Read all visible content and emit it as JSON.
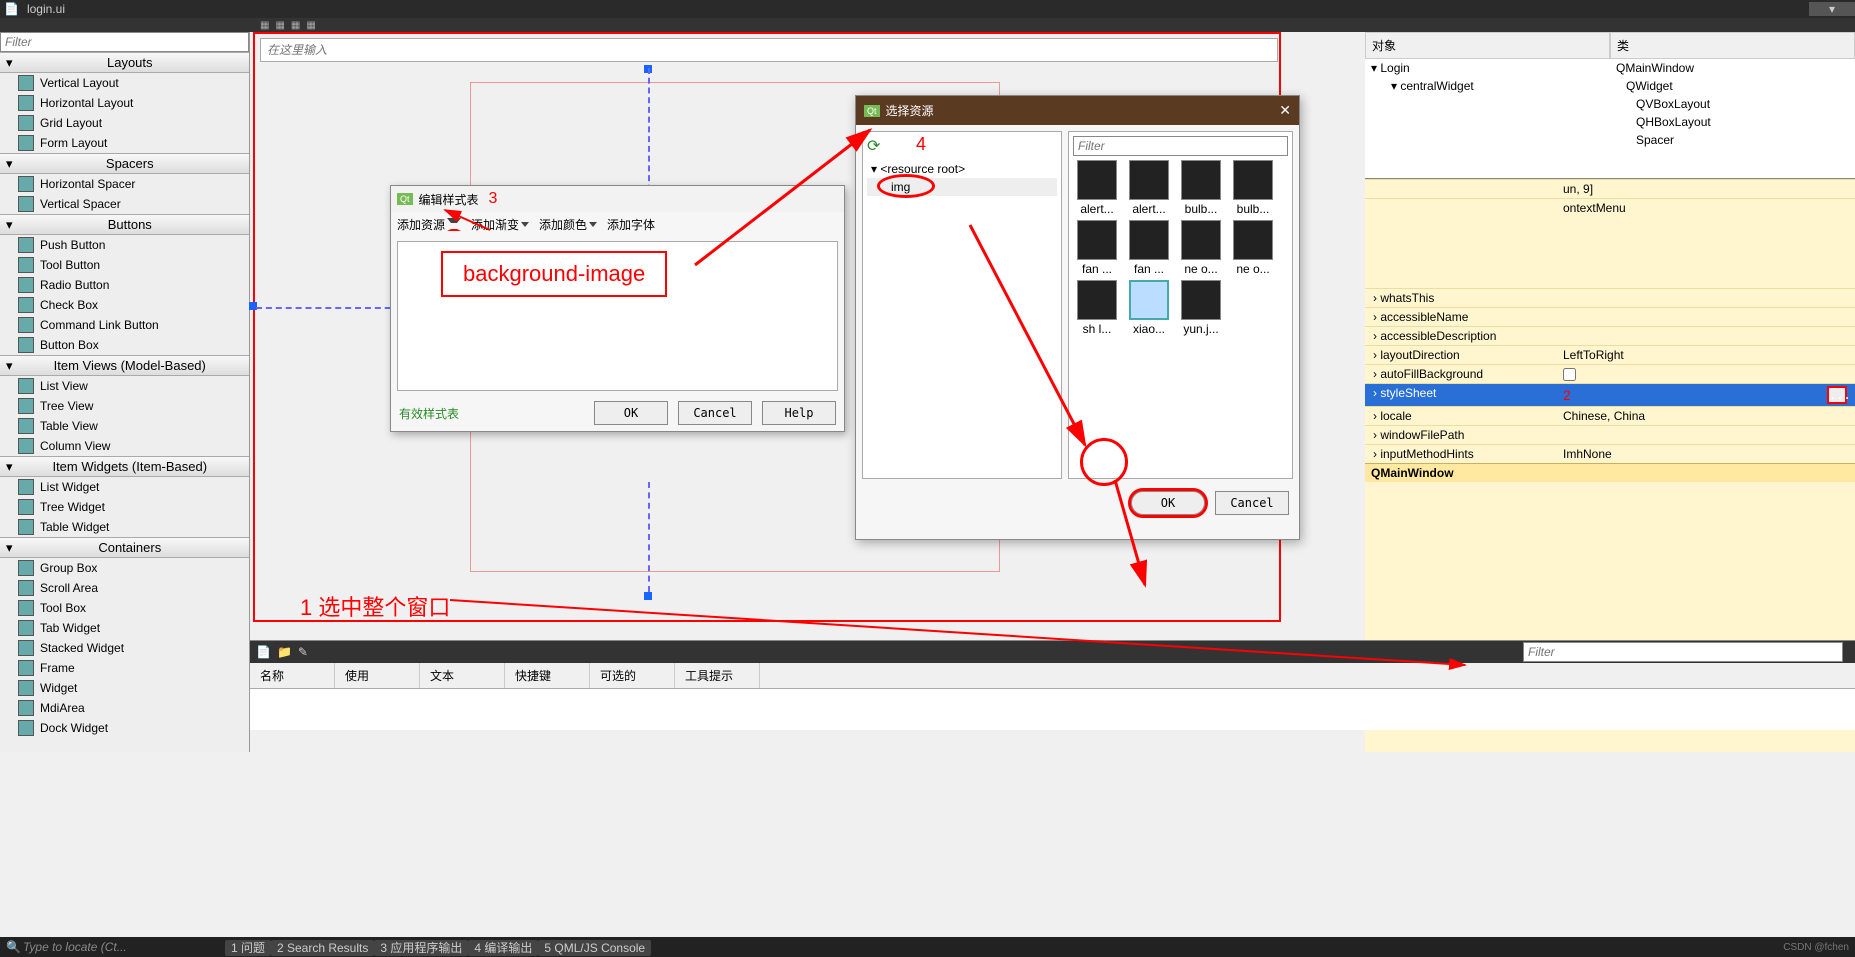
{
  "title_filename": "login.ui",
  "widgetbox": {
    "filter_placeholder": "Filter",
    "sections": [
      {
        "title": "Layouts",
        "items": [
          "Vertical Layout",
          "Horizontal Layout",
          "Grid Layout",
          "Form Layout"
        ]
      },
      {
        "title": "Spacers",
        "items": [
          "Horizontal Spacer",
          "Vertical Spacer"
        ]
      },
      {
        "title": "Buttons",
        "items": [
          "Push Button",
          "Tool Button",
          "Radio Button",
          "Check Box",
          "Command Link Button",
          "Button Box"
        ]
      },
      {
        "title": "Item Views (Model-Based)",
        "items": [
          "List View",
          "Tree View",
          "Table View",
          "Column View"
        ]
      },
      {
        "title": "Item Widgets (Item-Based)",
        "items": [
          "List Widget",
          "Tree Widget",
          "Table Widget"
        ]
      },
      {
        "title": "Containers",
        "items": [
          "Group Box",
          "Scroll Area",
          "Tool Box",
          "Tab Widget",
          "Stacked Widget",
          "Frame",
          "Widget",
          "MdiArea",
          "Dock Widget"
        ]
      }
    ]
  },
  "canvas": {
    "placeholder": "在这里输入",
    "annotation_1": "1 选中整个窗口"
  },
  "stylesheet_dialog": {
    "title": "编辑样式表",
    "menu_add_resource": "添加资源",
    "menu_add_gradient": "添加渐变",
    "menu_add_color": "添加颜色",
    "menu_add_font": "添加字体",
    "status": "有效样式表",
    "btn_ok": "OK",
    "btn_cancel": "Cancel",
    "btn_help": "Help",
    "annotation_3": "3",
    "annotation_bg": "background-image"
  },
  "resource_dialog": {
    "title": "选择资源",
    "filter_placeholder": "Filter",
    "root_label": "<resource root>",
    "folder_label": "img",
    "thumbs": [
      "alert...",
      "alert...",
      "bulb...",
      "bulb...",
      "fan ...",
      "fan ...",
      "ne o...",
      "ne o...",
      "sh l...",
      "xiao...",
      "yun.j..."
    ],
    "btn_ok": "OK",
    "btn_cancel": "Cancel",
    "annotation_4": "4"
  },
  "object_tree": {
    "col_obj": "对象",
    "col_class": "类",
    "rows": [
      {
        "obj": "Login",
        "cls": "QMainWindow"
      },
      {
        "obj": "centralWidget",
        "cls": "QWidget"
      },
      {
        "obj": "",
        "cls": "QVBoxLayout"
      },
      {
        "obj": "",
        "cls": "QHBoxLayout"
      },
      {
        "obj": "",
        "cls": "Spacer"
      }
    ]
  },
  "properties": {
    "visible_value_1": "un, 9]",
    "visible_value_2": "ontextMenu",
    "rows": [
      {
        "k": "whatsThis",
        "v": ""
      },
      {
        "k": "accessibleName",
        "v": ""
      },
      {
        "k": "accessibleDescription",
        "v": ""
      },
      {
        "k": "layoutDirection",
        "v": "LeftToRight"
      },
      {
        "k": "autoFillBackground",
        "v": ""
      },
      {
        "k": "styleSheet",
        "v": "",
        "selected": true
      },
      {
        "k": "locale",
        "v": "Chinese, China"
      },
      {
        "k": "windowFilePath",
        "v": ""
      },
      {
        "k": "inputMethodHints",
        "v": "ImhNone"
      }
    ],
    "group": "QMainWindow",
    "annotation_2": "2",
    "ellipsis": "..."
  },
  "action_editor": {
    "filter_placeholder": "Filter",
    "cols": [
      "名称",
      "使用",
      "文本",
      "快捷键",
      "可选的",
      "工具提示"
    ]
  },
  "statusbar": {
    "locator_placeholder": "Type to locate (Ct...",
    "tabs": [
      "1 问题",
      "2 Search Results",
      "3 应用程序输出",
      "4 编译输出",
      "5 QML/JS Console"
    ],
    "credit": "CSDN @fchen"
  }
}
